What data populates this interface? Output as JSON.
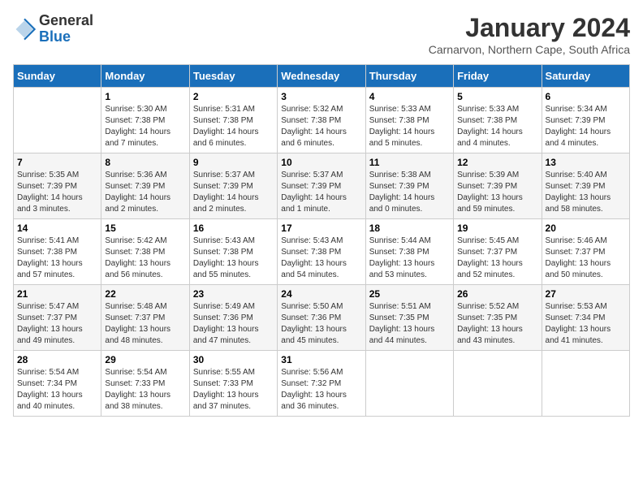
{
  "header": {
    "logo_general": "General",
    "logo_blue": "Blue",
    "title": "January 2024",
    "subtitle": "Carnarvon, Northern Cape, South Africa"
  },
  "calendar": {
    "weekdays": [
      "Sunday",
      "Monday",
      "Tuesday",
      "Wednesday",
      "Thursday",
      "Friday",
      "Saturday"
    ],
    "weeks": [
      [
        {
          "date": "",
          "info": ""
        },
        {
          "date": "1",
          "info": "Sunrise: 5:30 AM\nSunset: 7:38 PM\nDaylight: 14 hours\nand 7 minutes."
        },
        {
          "date": "2",
          "info": "Sunrise: 5:31 AM\nSunset: 7:38 PM\nDaylight: 14 hours\nand 6 minutes."
        },
        {
          "date": "3",
          "info": "Sunrise: 5:32 AM\nSunset: 7:38 PM\nDaylight: 14 hours\nand 6 minutes."
        },
        {
          "date": "4",
          "info": "Sunrise: 5:33 AM\nSunset: 7:38 PM\nDaylight: 14 hours\nand 5 minutes."
        },
        {
          "date": "5",
          "info": "Sunrise: 5:33 AM\nSunset: 7:38 PM\nDaylight: 14 hours\nand 4 minutes."
        },
        {
          "date": "6",
          "info": "Sunrise: 5:34 AM\nSunset: 7:39 PM\nDaylight: 14 hours\nand 4 minutes."
        }
      ],
      [
        {
          "date": "7",
          "info": "Sunrise: 5:35 AM\nSunset: 7:39 PM\nDaylight: 14 hours\nand 3 minutes."
        },
        {
          "date": "8",
          "info": "Sunrise: 5:36 AM\nSunset: 7:39 PM\nDaylight: 14 hours\nand 2 minutes."
        },
        {
          "date": "9",
          "info": "Sunrise: 5:37 AM\nSunset: 7:39 PM\nDaylight: 14 hours\nand 2 minutes."
        },
        {
          "date": "10",
          "info": "Sunrise: 5:37 AM\nSunset: 7:39 PM\nDaylight: 14 hours\nand 1 minute."
        },
        {
          "date": "11",
          "info": "Sunrise: 5:38 AM\nSunset: 7:39 PM\nDaylight: 14 hours\nand 0 minutes."
        },
        {
          "date": "12",
          "info": "Sunrise: 5:39 AM\nSunset: 7:39 PM\nDaylight: 13 hours\nand 59 minutes."
        },
        {
          "date": "13",
          "info": "Sunrise: 5:40 AM\nSunset: 7:39 PM\nDaylight: 13 hours\nand 58 minutes."
        }
      ],
      [
        {
          "date": "14",
          "info": "Sunrise: 5:41 AM\nSunset: 7:38 PM\nDaylight: 13 hours\nand 57 minutes."
        },
        {
          "date": "15",
          "info": "Sunrise: 5:42 AM\nSunset: 7:38 PM\nDaylight: 13 hours\nand 56 minutes."
        },
        {
          "date": "16",
          "info": "Sunrise: 5:43 AM\nSunset: 7:38 PM\nDaylight: 13 hours\nand 55 minutes."
        },
        {
          "date": "17",
          "info": "Sunrise: 5:43 AM\nSunset: 7:38 PM\nDaylight: 13 hours\nand 54 minutes."
        },
        {
          "date": "18",
          "info": "Sunrise: 5:44 AM\nSunset: 7:38 PM\nDaylight: 13 hours\nand 53 minutes."
        },
        {
          "date": "19",
          "info": "Sunrise: 5:45 AM\nSunset: 7:37 PM\nDaylight: 13 hours\nand 52 minutes."
        },
        {
          "date": "20",
          "info": "Sunrise: 5:46 AM\nSunset: 7:37 PM\nDaylight: 13 hours\nand 50 minutes."
        }
      ],
      [
        {
          "date": "21",
          "info": "Sunrise: 5:47 AM\nSunset: 7:37 PM\nDaylight: 13 hours\nand 49 minutes."
        },
        {
          "date": "22",
          "info": "Sunrise: 5:48 AM\nSunset: 7:37 PM\nDaylight: 13 hours\nand 48 minutes."
        },
        {
          "date": "23",
          "info": "Sunrise: 5:49 AM\nSunset: 7:36 PM\nDaylight: 13 hours\nand 47 minutes."
        },
        {
          "date": "24",
          "info": "Sunrise: 5:50 AM\nSunset: 7:36 PM\nDaylight: 13 hours\nand 45 minutes."
        },
        {
          "date": "25",
          "info": "Sunrise: 5:51 AM\nSunset: 7:35 PM\nDaylight: 13 hours\nand 44 minutes."
        },
        {
          "date": "26",
          "info": "Sunrise: 5:52 AM\nSunset: 7:35 PM\nDaylight: 13 hours\nand 43 minutes."
        },
        {
          "date": "27",
          "info": "Sunrise: 5:53 AM\nSunset: 7:34 PM\nDaylight: 13 hours\nand 41 minutes."
        }
      ],
      [
        {
          "date": "28",
          "info": "Sunrise: 5:54 AM\nSunset: 7:34 PM\nDaylight: 13 hours\nand 40 minutes."
        },
        {
          "date": "29",
          "info": "Sunrise: 5:54 AM\nSunset: 7:33 PM\nDaylight: 13 hours\nand 38 minutes."
        },
        {
          "date": "30",
          "info": "Sunrise: 5:55 AM\nSunset: 7:33 PM\nDaylight: 13 hours\nand 37 minutes."
        },
        {
          "date": "31",
          "info": "Sunrise: 5:56 AM\nSunset: 7:32 PM\nDaylight: 13 hours\nand 36 minutes."
        },
        {
          "date": "",
          "info": ""
        },
        {
          "date": "",
          "info": ""
        },
        {
          "date": "",
          "info": ""
        }
      ]
    ]
  }
}
